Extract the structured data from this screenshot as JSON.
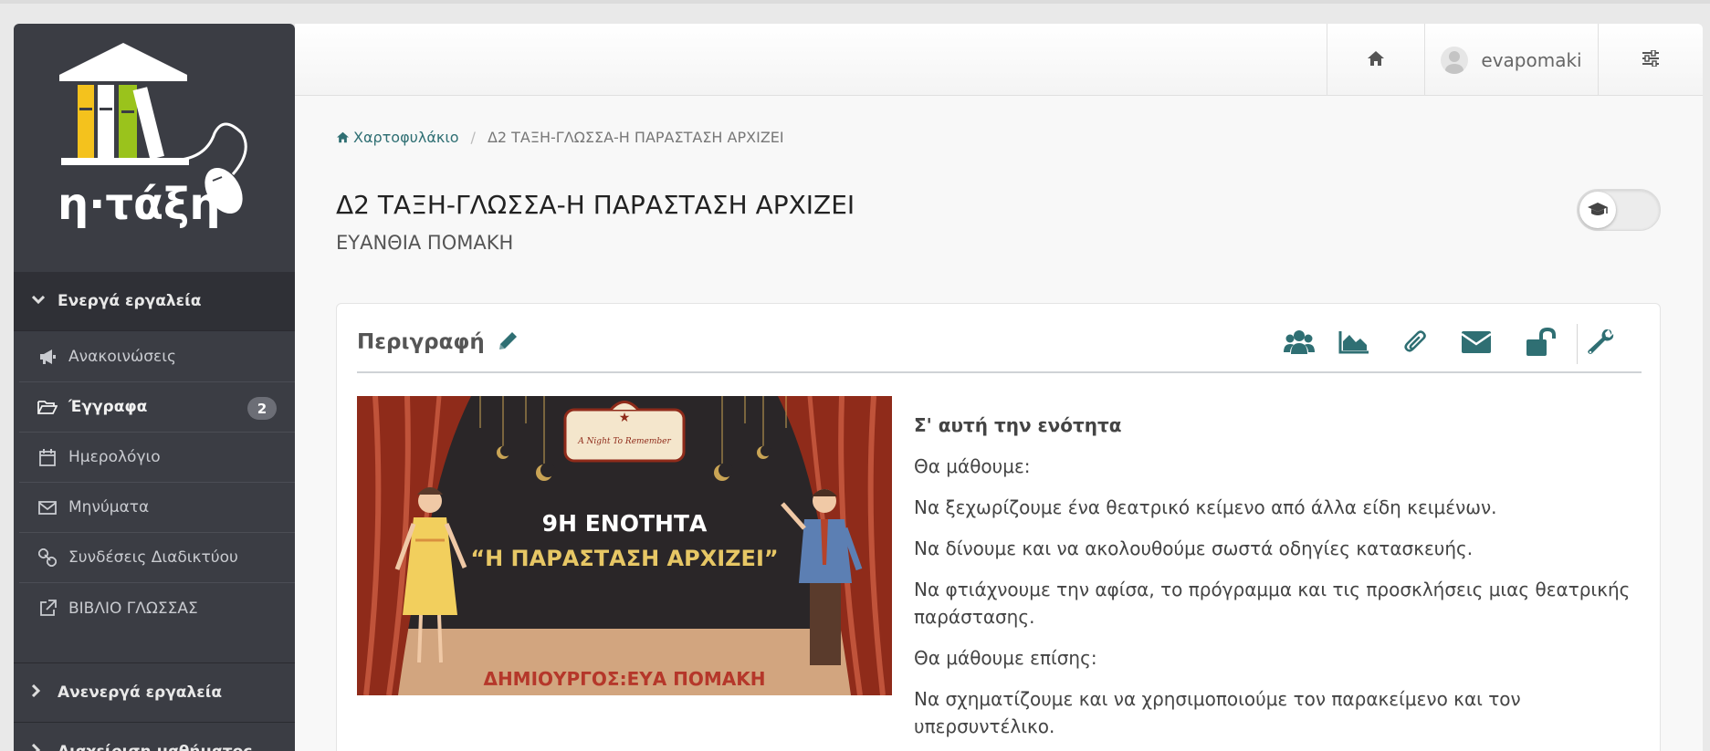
{
  "app": {
    "logo_text": "η·τάξη"
  },
  "sidebar": {
    "active_section_label": "Ενεργά εργαλεία",
    "items": [
      {
        "label": "Ανακοινώσεις",
        "icon": "megaphone-icon"
      },
      {
        "label": "Έγγραφα",
        "icon": "folder-open-icon",
        "badge": "2"
      },
      {
        "label": "Ημερολόγιο",
        "icon": "calendar-icon"
      },
      {
        "label": "Μηνύματα",
        "icon": "envelope-icon"
      },
      {
        "label": "Συνδέσεις Διαδικτύου",
        "icon": "link-icon"
      },
      {
        "label": "ΒΙΒΛΙΟ ΓΛΩΣΣΑΣ",
        "icon": "external-link-icon"
      }
    ],
    "inactive_section_label": "Ανενεργά εργαλεία",
    "admin_section_label": "Διαχείριση μαθήματος"
  },
  "topbar": {
    "username": "evapomaki",
    "home_icon": "home-icon",
    "settings_icon": "sliders-icon"
  },
  "breadcrumb": {
    "root": "Χαρτοφυλάκιο",
    "current": "Δ2 ΤΑΞΗ-ΓΛΩΣΣΑ-Η ΠΑΡΑΣΤΑΣΗ ΑΡΧΙΖΕΙ"
  },
  "course": {
    "title": "Δ2 ΤΑΞΗ-ΓΛΩΣΣΑ-Η ΠΑΡΑΣΤΑΣΗ ΑΡΧΙΖΕΙ",
    "instructor": "ΕΥΑΝΘΙΑ ΠΟΜΑΚΗ"
  },
  "panel": {
    "title": "Περιγραφή",
    "tools": [
      "users-icon",
      "area-chart-icon",
      "paperclip-icon",
      "envelope-icon",
      "unlock-icon",
      "wrench-icon"
    ]
  },
  "banner": {
    "sign": "A Night To Remember",
    "line1": "9Η ΕΝΟΤΗΤΑ",
    "line2": "“Η ΠΑΡΑΣΤΑΣΗ ΑΡΧΙΖΕΙ”",
    "footer": "ΔΗΜΙΟΥΡΓΟΣ:ΕΥΑ ΠΟΜΑΚΗ"
  },
  "description": {
    "heading": "Σ' αυτή την ενότητα",
    "p1": "Θα μάθουμε:",
    "p2": "Να ξεχωρίζουμε ένα θεατρικό κείμενο από άλλα είδη κειμένων.",
    "p3": "Να δίνουμε και να ακολουθούμε σωστά οδηγίες κατασκευής.",
    "p4": "Να φτιάχνουμε την αφίσα, το πρόγραμμα και τις προσκλήσεις μιας θεατρικής παράστασης.",
    "p5": "Θα μάθουμε επίσης:",
    "p6": "Να σχηματίζουμε και να χρησιμοποιούμε τον παρακείμενο και τον υπερσυντέλικο."
  },
  "colors": {
    "sidebar_bg": "#3b3d44",
    "accent": "#2f6f73",
    "tool_icon": "#2f6f73"
  }
}
